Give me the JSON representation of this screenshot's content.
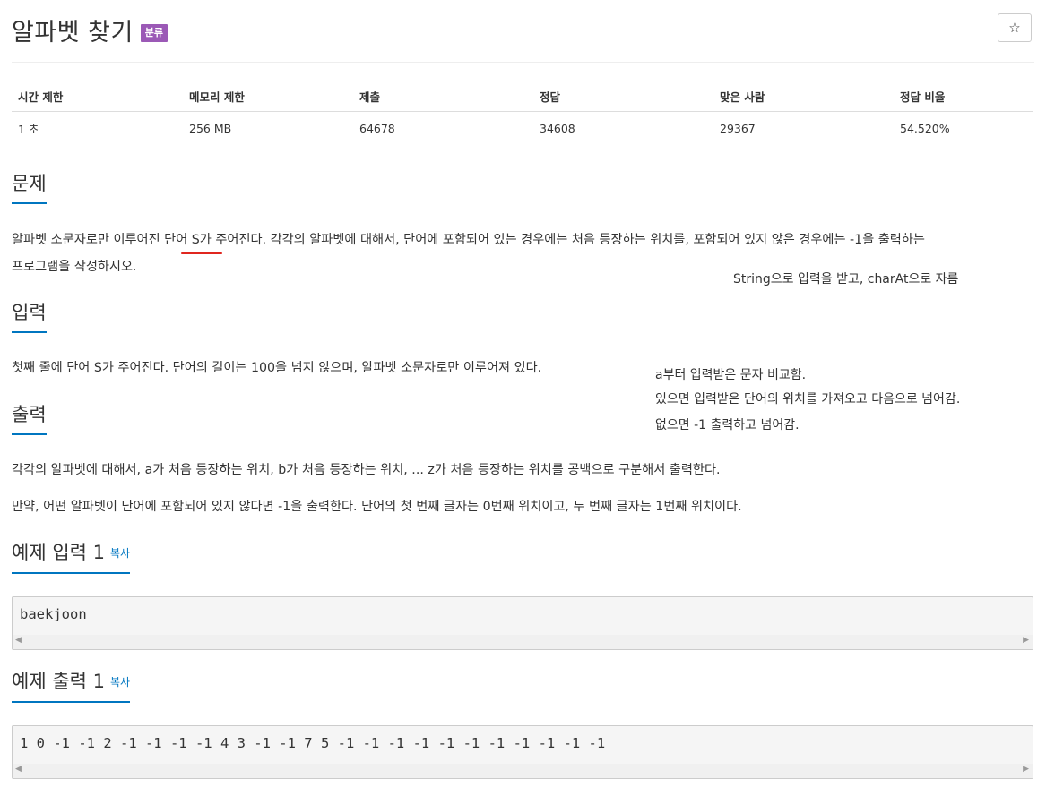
{
  "title": "알파벳 찾기",
  "badge": "분류",
  "star_icon": "☆",
  "info": {
    "headers": [
      "시간 제한",
      "메모리 제한",
      "제출",
      "정답",
      "맞은 사람",
      "정답 비율"
    ],
    "values": [
      "1 초",
      "256 MB",
      "64678",
      "34608",
      "29367",
      "54.520%"
    ]
  },
  "sections": {
    "problem": {
      "heading": "문제",
      "line1": "알파벳 소문자로만 이루어진 단어 S가 주어진다. 각각의 알파벳에 대해서, 단어에 포함되어 있는 경우에는 처음 등장하는 위치를, 포함되어 있지 않은 경우에는 -1을 출력하는",
      "line2": "프로그램을 작성하시오."
    },
    "input": {
      "heading": "입력",
      "text": "첫째 줄에 단어 S가 주어진다. 단어의 길이는 100을 넘지 않으며, 알파벳 소문자로만 이루어져 있다."
    },
    "output": {
      "heading": "출력",
      "line1": "각각의 알파벳에 대해서, a가 처음 등장하는 위치, b가 처음 등장하는 위치, ... z가 처음 등장하는 위치를 공백으로 구분해서 출력한다.",
      "line2": "만약, 어떤 알파벳이 단어에 포함되어 있지 않다면 -1을 출력한다. 단어의 첫 번째 글자는 0번째 위치이고, 두 번째 글자는 1번째 위치이다."
    },
    "sample_input": {
      "heading": "예제 입력 1",
      "copy": "복사",
      "code": "baekjoon"
    },
    "sample_output": {
      "heading": "예제 출력 1",
      "copy": "복사",
      "code": "1 0 -1 -1 2 -1 -1 -1 -1 4 3 -1 -1 7 5 -1 -1 -1 -1 -1 -1 -1 -1 -1 -1 -1"
    }
  },
  "notes": {
    "note1": "String으로 입력을 받고, charAt으로 자름",
    "note2_line1": "a부터 입력받은 문자 비교함.",
    "note2_line2": "있으면 입력받은 단어의 위치를 가져오고 다음으로 넘어감.",
    "note2_line3": "없으면 -1 출력하고 넘어감."
  },
  "scroll_arrows": {
    "left": "◀",
    "right": "▶"
  },
  "colors": {
    "badge": "#9b59b6",
    "accent": "#0076c0",
    "annotation_underline": "#e0261f"
  }
}
